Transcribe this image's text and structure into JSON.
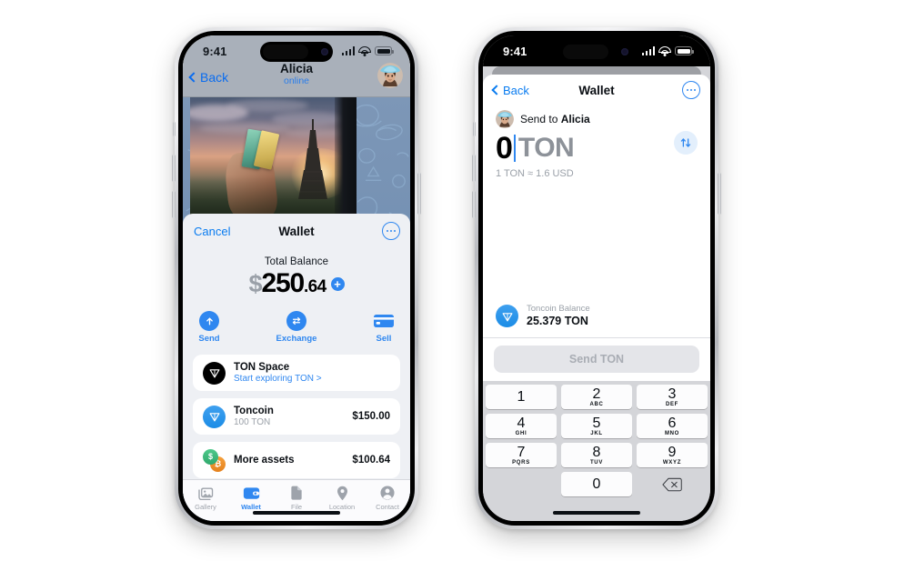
{
  "status_bar": {
    "time": "9:41",
    "signal_icon": "cellular-signal-icon",
    "wifi_icon": "wifi-icon",
    "battery_icon": "battery-icon"
  },
  "colors": {
    "accent_blue": "#2f87f0",
    "link_blue": "#0a7cf0",
    "sheet_bg": "#eef0f4",
    "keypad_bg": "#d4d5d9",
    "disabled_gray": "#a9adb4"
  },
  "left_phone": {
    "chat": {
      "back_label": "Back",
      "contact_name": "Alicia",
      "contact_status": "online",
      "avatar_name": "alicia-avatar"
    },
    "wallet_sheet": {
      "cancel_label": "Cancel",
      "title": "Wallet",
      "more_button": "more-options-icon",
      "balance_label": "Total Balance",
      "balance_currency": "$",
      "balance_integer": "250",
      "balance_decimal": ".64",
      "add_button_label": "+",
      "actions": [
        {
          "label": "Send",
          "icon": "arrow-up-circle-icon"
        },
        {
          "label": "Exchange",
          "icon": "exchange-arrows-circle-icon"
        },
        {
          "label": "Sell",
          "icon": "credit-card-icon"
        }
      ],
      "assets": [
        {
          "name": "TON Space",
          "sub": "Start exploring TON >",
          "sub_is_link": true,
          "value": "",
          "icon": "ton-diamond-black-icon"
        },
        {
          "name": "Toncoin",
          "sub": "100 TON",
          "sub_is_link": false,
          "value": "$150.00",
          "icon": "ton-diamond-blue-icon"
        },
        {
          "name": "More assets",
          "sub": "",
          "sub_is_link": false,
          "value": "$100.64",
          "icon": "multi-coin-icon"
        }
      ]
    },
    "tab_bar": {
      "items": [
        {
          "label": "Gallery",
          "icon": "gallery-icon",
          "active": false
        },
        {
          "label": "Wallet",
          "icon": "wallet-icon",
          "active": true
        },
        {
          "label": "File",
          "icon": "file-icon",
          "active": false
        },
        {
          "label": "Location",
          "icon": "location-pin-icon",
          "active": false
        },
        {
          "label": "Contact",
          "icon": "contact-person-icon",
          "active": false
        }
      ]
    }
  },
  "right_phone": {
    "nav": {
      "back_label": "Back",
      "title": "Wallet",
      "more_button": "more-options-icon"
    },
    "send_to": {
      "prefix": "Send to ",
      "recipient": "Alicia",
      "avatar_name": "alicia-avatar"
    },
    "amount": {
      "value": "0",
      "unit": "TON",
      "swap_icon": "swap-vertical-icon"
    },
    "rate": "1 TON ≈ 1.6 USD",
    "balance": {
      "label": "Toncoin Balance",
      "value": "25.379 TON",
      "icon": "ton-diamond-blue-icon"
    },
    "send_button": {
      "label": "Send TON",
      "disabled": true
    },
    "keypad": {
      "keys": [
        {
          "num": "1",
          "sub": ""
        },
        {
          "num": "2",
          "sub": "ABC"
        },
        {
          "num": "3",
          "sub": "DEF"
        },
        {
          "num": "4",
          "sub": "GHI"
        },
        {
          "num": "5",
          "sub": "JKL"
        },
        {
          "num": "6",
          "sub": "MNO"
        },
        {
          "num": "7",
          "sub": "PQRS"
        },
        {
          "num": "8",
          "sub": "TUV"
        },
        {
          "num": "9",
          "sub": "WXYZ"
        },
        {
          "num": "0",
          "sub": ""
        }
      ],
      "delete_icon": "backspace-icon"
    }
  }
}
